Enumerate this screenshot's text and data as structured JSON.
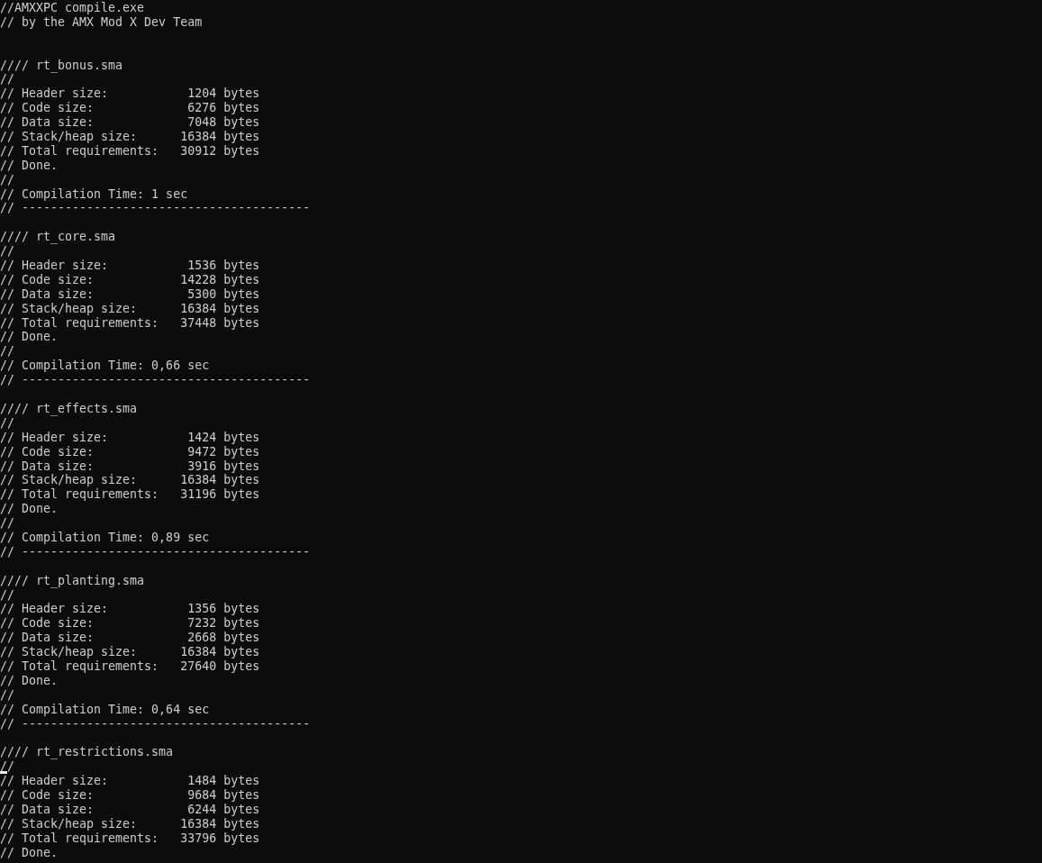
{
  "console": {
    "lines": [
      {
        "kind": "text",
        "text": "//AMXXPC compile.exe",
        "cursor": false
      },
      {
        "kind": "text",
        "text": "// by the AMX Mod X Dev Team",
        "cursor": false
      },
      {
        "kind": "blank"
      },
      {
        "kind": "blank"
      },
      {
        "kind": "text",
        "text": "//// rt_bonus.sma",
        "cursor": false
      },
      {
        "kind": "text",
        "text": "//",
        "cursor": false
      },
      {
        "kind": "text",
        "text": "// Header size:           1204 bytes",
        "cursor": false
      },
      {
        "kind": "text",
        "text": "// Code size:             6276 bytes",
        "cursor": false
      },
      {
        "kind": "text",
        "text": "// Data size:             7048 bytes",
        "cursor": false
      },
      {
        "kind": "text",
        "text": "// Stack/heap size:      16384 bytes",
        "cursor": false
      },
      {
        "kind": "text",
        "text": "// Total requirements:   30912 bytes",
        "cursor": false
      },
      {
        "kind": "text",
        "text": "// Done.",
        "cursor": false
      },
      {
        "kind": "text",
        "text": "//",
        "cursor": false
      },
      {
        "kind": "text",
        "text": "// Compilation Time: 1 sec",
        "cursor": false
      },
      {
        "kind": "text",
        "text": "// ----------------------------------------",
        "cursor": false
      },
      {
        "kind": "blank"
      },
      {
        "kind": "text",
        "text": "//// rt_core.sma",
        "cursor": false
      },
      {
        "kind": "text",
        "text": "//",
        "cursor": false
      },
      {
        "kind": "text",
        "text": "// Header size:           1536 bytes",
        "cursor": false
      },
      {
        "kind": "text",
        "text": "// Code size:            14228 bytes",
        "cursor": false
      },
      {
        "kind": "text",
        "text": "// Data size:             5300 bytes",
        "cursor": false
      },
      {
        "kind": "text",
        "text": "// Stack/heap size:      16384 bytes",
        "cursor": false
      },
      {
        "kind": "text",
        "text": "// Total requirements:   37448 bytes",
        "cursor": false
      },
      {
        "kind": "text",
        "text": "// Done.",
        "cursor": false
      },
      {
        "kind": "text",
        "text": "//",
        "cursor": false
      },
      {
        "kind": "text",
        "text": "// Compilation Time: 0,66 sec",
        "cursor": false
      },
      {
        "kind": "text",
        "text": "// ----------------------------------------",
        "cursor": false
      },
      {
        "kind": "blank"
      },
      {
        "kind": "text",
        "text": "//// rt_effects.sma",
        "cursor": false
      },
      {
        "kind": "text",
        "text": "//",
        "cursor": false
      },
      {
        "kind": "text",
        "text": "// Header size:           1424 bytes",
        "cursor": false
      },
      {
        "kind": "text",
        "text": "// Code size:             9472 bytes",
        "cursor": false
      },
      {
        "kind": "text",
        "text": "// Data size:             3916 bytes",
        "cursor": false
      },
      {
        "kind": "text",
        "text": "// Stack/heap size:      16384 bytes",
        "cursor": false
      },
      {
        "kind": "text",
        "text": "// Total requirements:   31196 bytes",
        "cursor": false
      },
      {
        "kind": "text",
        "text": "// Done.",
        "cursor": false
      },
      {
        "kind": "text",
        "text": "//",
        "cursor": false
      },
      {
        "kind": "text",
        "text": "// Compilation Time: 0,89 sec",
        "cursor": false
      },
      {
        "kind": "text",
        "text": "// ----------------------------------------",
        "cursor": false
      },
      {
        "kind": "blank"
      },
      {
        "kind": "text",
        "text": "//// rt_planting.sma",
        "cursor": false
      },
      {
        "kind": "text",
        "text": "//",
        "cursor": false
      },
      {
        "kind": "text",
        "text": "// Header size:           1356 bytes",
        "cursor": false
      },
      {
        "kind": "text",
        "text": "// Code size:             7232 bytes",
        "cursor": false
      },
      {
        "kind": "text",
        "text": "// Data size:             2668 bytes",
        "cursor": false
      },
      {
        "kind": "text",
        "text": "// Stack/heap size:      16384 bytes",
        "cursor": false
      },
      {
        "kind": "text",
        "text": "// Total requirements:   27640 bytes",
        "cursor": false
      },
      {
        "kind": "text",
        "text": "// Done.",
        "cursor": false
      },
      {
        "kind": "text",
        "text": "//",
        "cursor": false
      },
      {
        "kind": "text",
        "text": "// Compilation Time: 0,64 sec",
        "cursor": false
      },
      {
        "kind": "text",
        "text": "// ----------------------------------------",
        "cursor": false
      },
      {
        "kind": "blank"
      },
      {
        "kind": "text",
        "text": "//// rt_restrictions.sma",
        "cursor": false
      },
      {
        "kind": "text",
        "text": "//",
        "cursor": true
      },
      {
        "kind": "text",
        "text": "// Header size:           1484 bytes",
        "cursor": false
      },
      {
        "kind": "text",
        "text": "// Code size:             9684 bytes",
        "cursor": false
      },
      {
        "kind": "text",
        "text": "// Data size:             6244 bytes",
        "cursor": false
      },
      {
        "kind": "text",
        "text": "// Stack/heap size:      16384 bytes",
        "cursor": false
      },
      {
        "kind": "text",
        "text": "// Total requirements:   33796 bytes",
        "cursor": false
      },
      {
        "kind": "text",
        "text": "// Done.",
        "cursor": false
      }
    ]
  }
}
